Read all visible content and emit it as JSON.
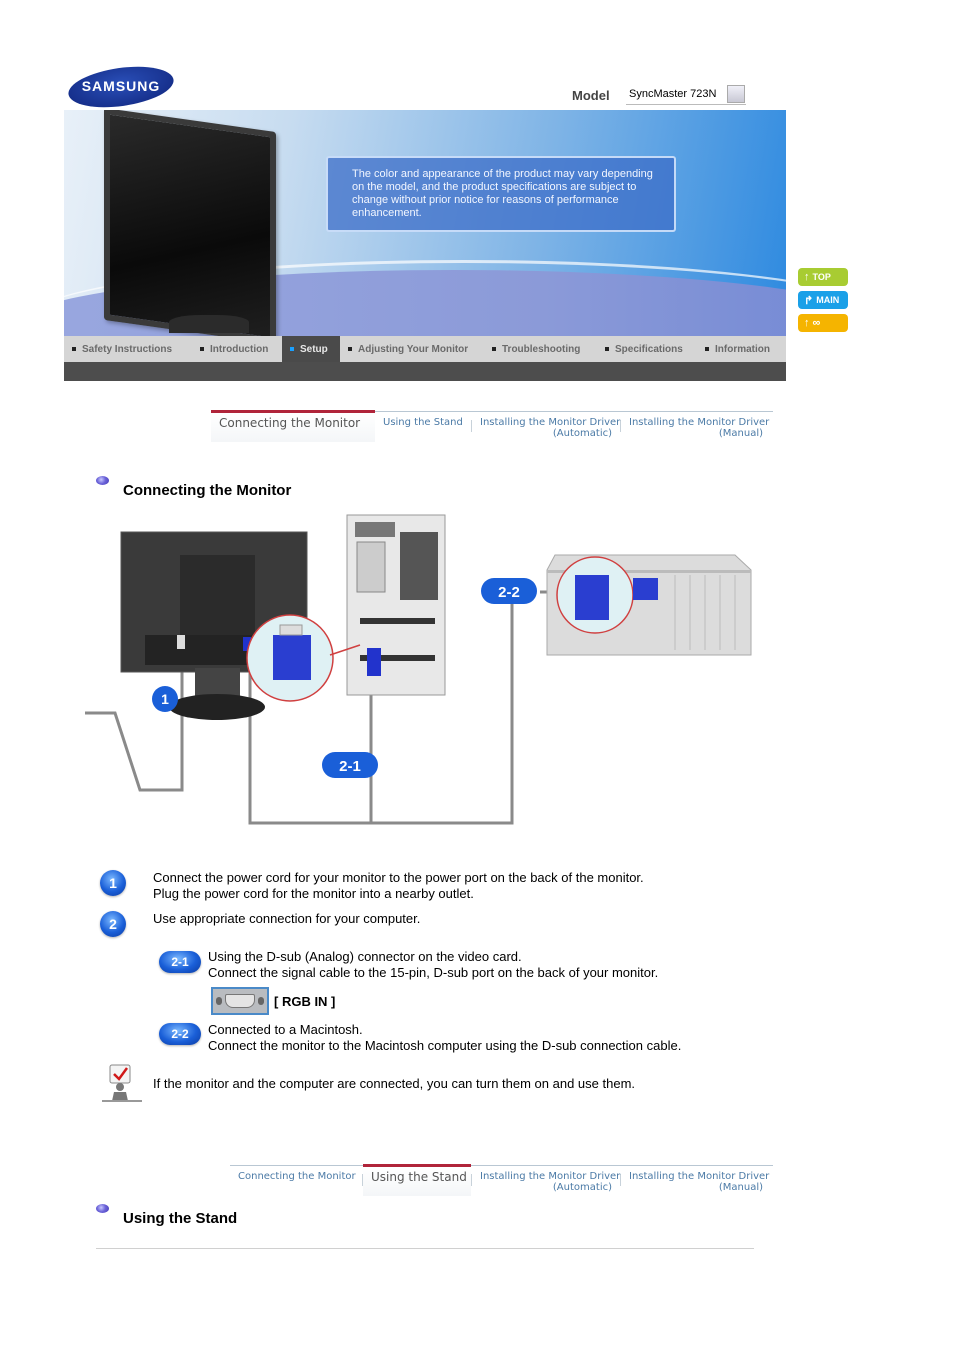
{
  "header": {
    "logo_text": "SAMSUNG",
    "model_label": "Model",
    "model_value": "SyncMaster 723N"
  },
  "banner": {
    "notice": "The color and appearance of the product may vary depending on the model, and the product specifications are subject to change without prior notice for reasons of performance enhancement."
  },
  "nav": {
    "items": [
      {
        "label": "Safety Instructions",
        "active": false
      },
      {
        "label": "Introduction",
        "active": false
      },
      {
        "label": "Setup",
        "active": true
      },
      {
        "label": "Adjusting Your Monitor",
        "active": false
      },
      {
        "label": "Troubleshooting",
        "active": false
      },
      {
        "label": "Specifications",
        "active": false
      },
      {
        "label": "Information",
        "active": false
      }
    ]
  },
  "side_buttons": [
    {
      "label": "TOP",
      "icon": "arrow-up-icon",
      "color": "#a8cc32"
    },
    {
      "label": "MAIN",
      "icon": "arrow-return-icon",
      "color": "#1aa0e8"
    },
    {
      "label": "",
      "icon": "arrow-up-link-icon",
      "color": "#f5b400"
    }
  ],
  "subnav": {
    "tabs": [
      {
        "line1": "Connecting the Monitor",
        "line2": ""
      },
      {
        "line1": "Using the Stand",
        "line2": ""
      },
      {
        "line1": "Installing the Monitor Driver",
        "line2": "(Automatic)"
      },
      {
        "line1": "Installing the Monitor Driver",
        "line2": "(Manual)"
      }
    ]
  },
  "section1": {
    "title": "Connecting the Monitor",
    "diagram_labels": [
      "1",
      "2-1",
      "2-2"
    ],
    "steps": [
      {
        "icon": "1",
        "lines": [
          "Connect the power cord for your monitor to the power port on the back of the monitor.",
          "Plug the power cord for the monitor into a nearby outlet."
        ]
      },
      {
        "icon": "2",
        "lines": [
          "Use appropriate connection for your computer."
        ]
      }
    ],
    "substeps": [
      {
        "icon": "2-1",
        "lines": [
          "Using the D-sub (Analog) connector on the video card.",
          "Connect the signal cable to the 15-pin, D-sub port on the back of your monitor."
        ]
      },
      {
        "icon": "2-2",
        "lines": [
          "Connected to a Macintosh.",
          "Connect the monitor to the Macintosh computer using the D-sub connection cable."
        ]
      }
    ],
    "port_label": "[ RGB IN ]",
    "note": "If the monitor and the computer are connected, you can turn them on and use them."
  },
  "section2": {
    "title": "Using the Stand"
  },
  "colors": {
    "active_tab_border": "#b0243a",
    "tab_text": "#4b7aa6",
    "nav_active_bg": "#4a4a4a",
    "nav_bg": "#d5d5d5"
  }
}
